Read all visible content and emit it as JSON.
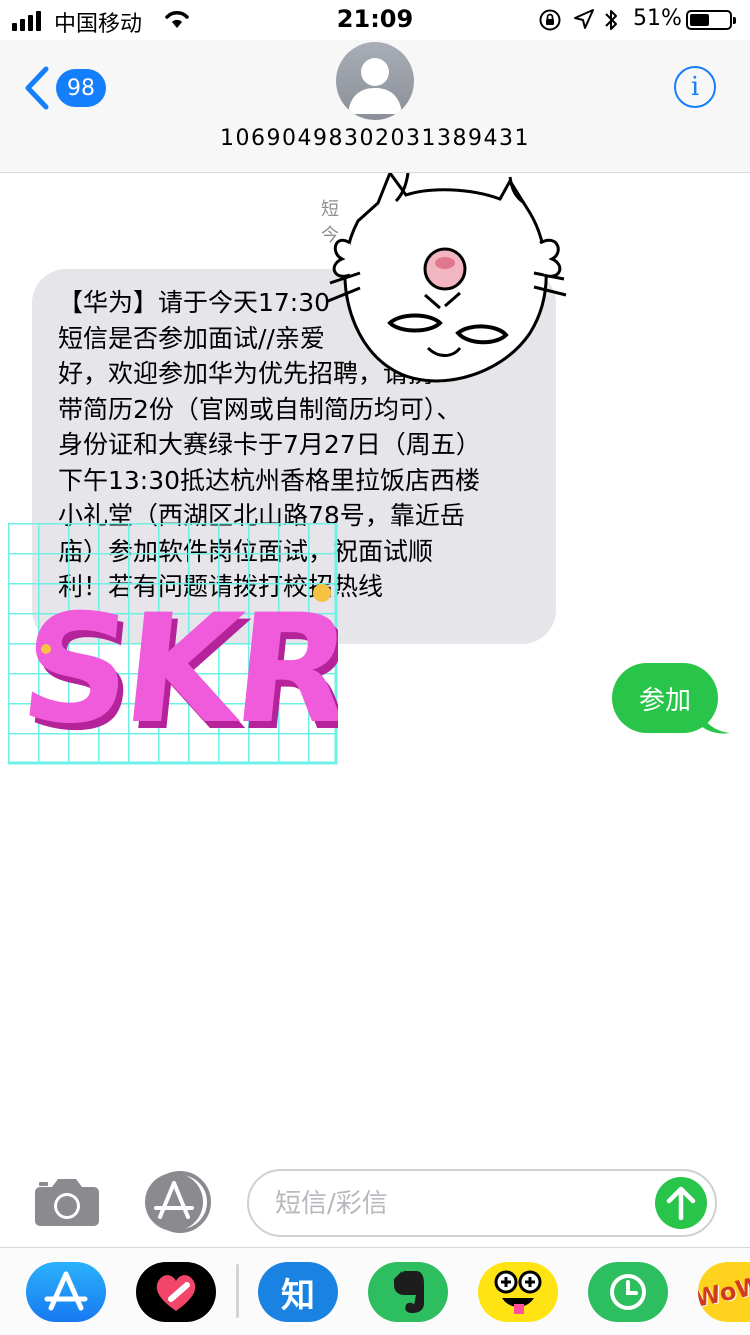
{
  "status_bar": {
    "carrier": "中国移动",
    "time": "21:09",
    "battery_percent": "51%",
    "battery_level": 0.51,
    "icons": [
      "signal-bars-icon",
      "wifi-icon",
      "orientation-lock-icon",
      "location-arrow-icon",
      "bluetooth-icon",
      "battery-icon"
    ]
  },
  "header": {
    "back_count": "98",
    "contact_number": "1069049830203138943​1",
    "info_icon": "i"
  },
  "conversation": {
    "meta_line_1": "短",
    "meta_line_2": "今",
    "incoming_message_lines": [
      "【华为】请于今天17:30",
      "短信是否参加面试//亲爱",
      "好，欢迎参加华为优先招聘，请携",
      "带简历2份（官网或自制简历均可）、",
      "身份证和大赛绿卡于7月27日（周五）",
      "下午13:30抵达杭州香格里拉饭店西楼",
      "小礼堂（西湖区北山路78号，靠近岳",
      "庙）参加软件岗位面试，祝面试顺",
      "利！若有问题请拨打校招热线"
    ],
    "outgoing_message": "参加",
    "sticker_text": "SKR"
  },
  "input_bar": {
    "placeholder": "短信/彩信",
    "value": ""
  },
  "app_drawer": {
    "apps": [
      {
        "name": "App Store",
        "icon": "appstore-icon"
      },
      {
        "name": "Digital Touch",
        "icon": "heart-touch-icon"
      },
      {
        "name": "知乎",
        "label": "知",
        "icon": "zhihu-icon"
      },
      {
        "name": "Evernote",
        "icon": "evernote-icon"
      },
      {
        "name": "Emoji Stickers",
        "icon": "emoji-face-icon"
      },
      {
        "name": "Clock",
        "icon": "clock-icon"
      },
      {
        "name": "Wow",
        "label": "WoW",
        "icon": "wow-sticker-icon"
      }
    ]
  },
  "colors": {
    "ios_blue": "#157efb",
    "imessage_green": "#29c54b",
    "incoming_bubble": "#e5e5ea",
    "sticker_pink": "#f05bdc",
    "sticker_grid": "#6ff0e6"
  }
}
